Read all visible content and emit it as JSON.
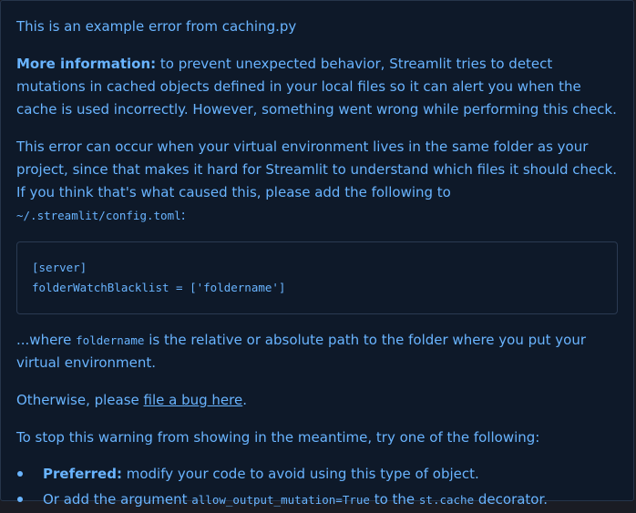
{
  "alert": {
    "title_line": "This is an example error from caching.py",
    "more_info": {
      "label": "More information:",
      "text": " to prevent unexpected behavior, Streamlit tries to detect mutations in cached objects defined in your local files so it can alert you when the cache is used incorrectly. However, something went wrong while performing this check."
    },
    "venv_paragraph": {
      "text_before": "This error can occur when your virtual environment lives in the same folder as your project, since that makes it hard for Streamlit to understand which files it should check. If you think that's what caused this, please add the following to ",
      "config_path": "~/.streamlit/config.toml",
      "text_after": ":"
    },
    "code_block": {
      "line1": "[server]",
      "line2": "folderWatchBlacklist = ['foldername']"
    },
    "where_paragraph": {
      "text_before": "...where ",
      "code": "foldername",
      "text_after": " is the relative or absolute path to the folder where you put your virtual environment."
    },
    "otherwise_paragraph": {
      "text_before": "Otherwise, please ",
      "link_text": "file a bug here",
      "text_after": "."
    },
    "stop_warning": "To stop this warning from showing in the meantime, try one of the following:",
    "options": [
      {
        "label": "Preferred:",
        "text": " modify your code to avoid using this type of object."
      },
      {
        "text_before": "Or add the argument ",
        "code1": "allow_output_mutation=True",
        "text_middle": " to the ",
        "code2": "st.cache",
        "text_after": " decorator."
      }
    ]
  },
  "colors": {
    "background": "#0e1929",
    "text": "#69b4ff",
    "border": "#26354a"
  }
}
